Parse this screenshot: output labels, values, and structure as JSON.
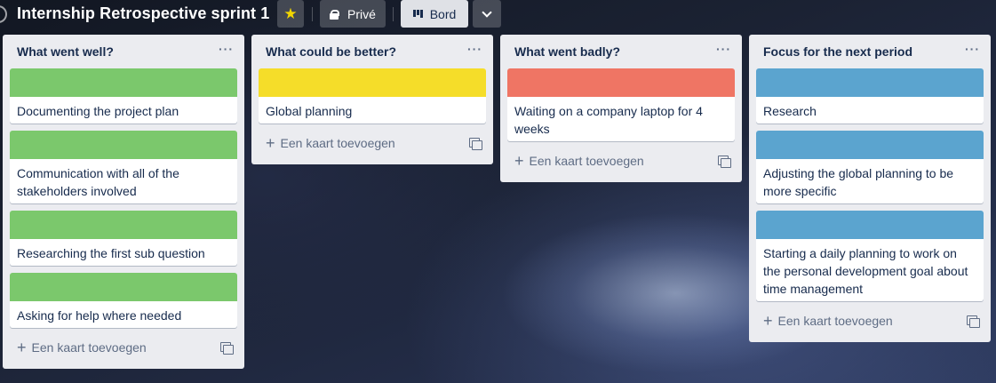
{
  "header": {
    "title": "Internship Retrospective sprint 1",
    "visibility_label": "Privé",
    "view_label": "Bord"
  },
  "colors": {
    "green": "#7bc86c",
    "yellow": "#f5dd29",
    "red": "#ef7564",
    "blue": "#5ba4cf"
  },
  "add_card_label": "Een kaart toevoegen",
  "lists": [
    {
      "title": "What went well?",
      "cards": [
        {
          "text": "Documenting the project plan",
          "cover": "green"
        },
        {
          "text": "Communication with all of the stakeholders involved",
          "cover": "green"
        },
        {
          "text": "Researching the first sub question",
          "cover": "green"
        },
        {
          "text": "Asking for help where needed",
          "cover": "green"
        }
      ]
    },
    {
      "title": "What could be better?",
      "cards": [
        {
          "text": "Global planning",
          "cover": "yellow"
        }
      ]
    },
    {
      "title": "What went badly?",
      "cards": [
        {
          "text": "Waiting on a company laptop for 4 weeks",
          "cover": "red"
        }
      ]
    },
    {
      "title": "Focus for the next period",
      "cards": [
        {
          "text": "Research",
          "cover": "blue"
        },
        {
          "text": "Adjusting the global planning to be more specific",
          "cover": "blue"
        },
        {
          "text": "Starting a daily planning to work on the personal development goal about time management",
          "cover": "blue"
        }
      ]
    }
  ]
}
